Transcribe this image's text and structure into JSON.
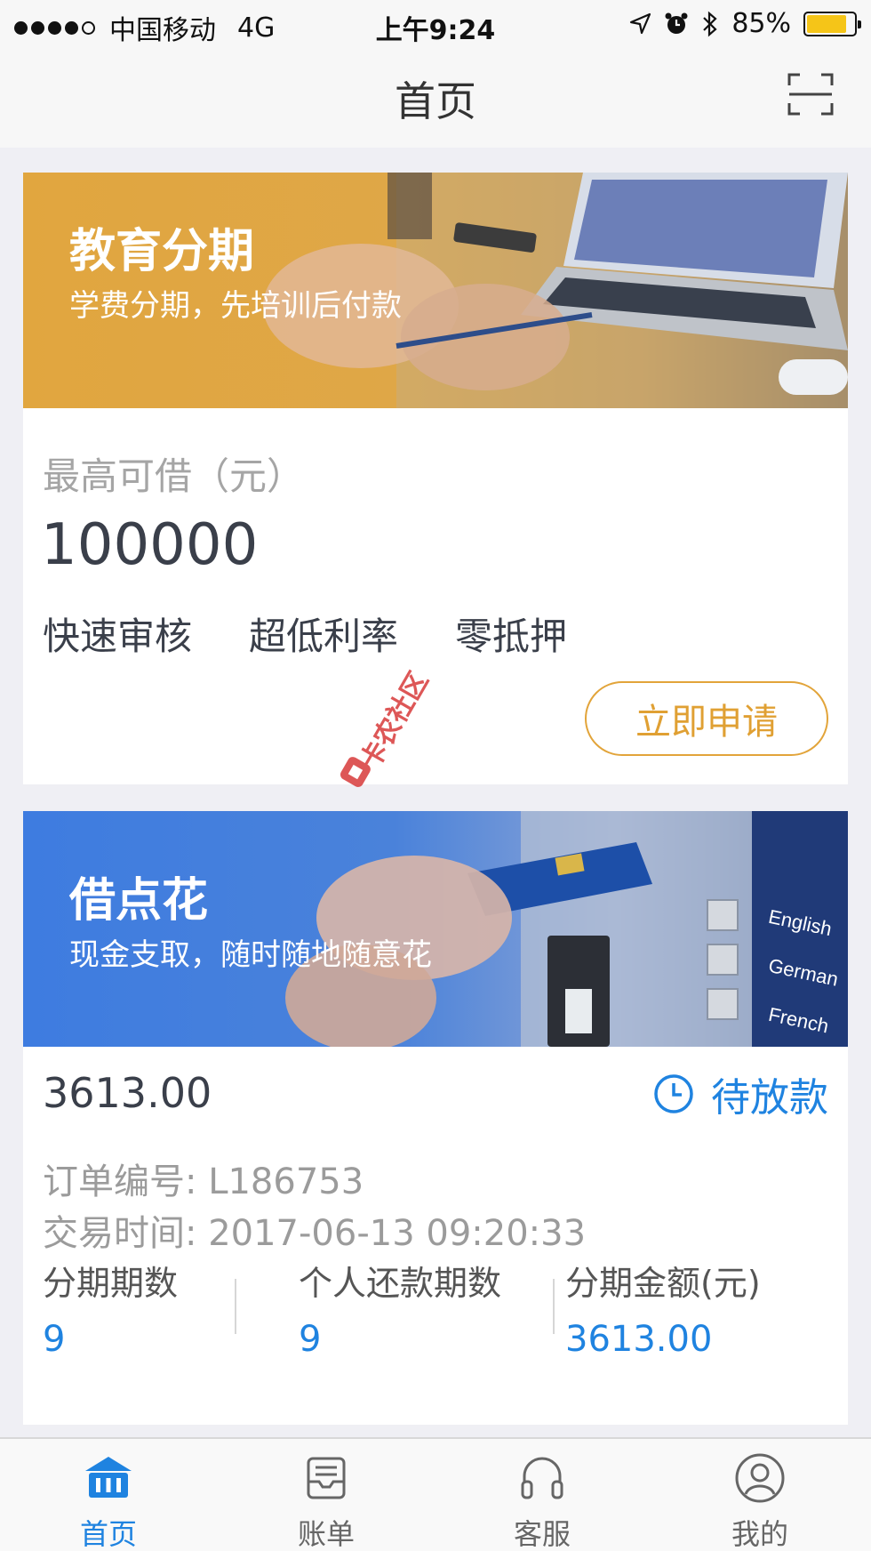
{
  "status_bar": {
    "carrier": "中国移动",
    "network": "4G",
    "time": "上午9:24",
    "battery": "85%",
    "battery_level": 0.85
  },
  "nav": {
    "title": "首页"
  },
  "edu_card": {
    "banner_title": "教育分期",
    "banner_subtitle": "学费分期，先培训后付款",
    "max_label": "最高可借（元）",
    "max_amount": "100000",
    "features": [
      "快速审核",
      "超低利率",
      "零抵押"
    ],
    "apply_button": "立即申请"
  },
  "cash_card": {
    "banner_title": "借点花",
    "banner_subtitle": "现金支取，随时随地随意花",
    "amount": "3613.00",
    "status": "待放款",
    "order_no": "订单编号: L186753",
    "trade_time": "交易时间: 2017-06-13 09:20:33",
    "stats": [
      {
        "label": "分期期数",
        "value": "9"
      },
      {
        "label": "个人还款期数",
        "value": "9"
      },
      {
        "label": "分期金额(元)",
        "value": "3613.00"
      }
    ]
  },
  "watermark": "卡农社区",
  "tabbar": {
    "items": [
      {
        "label": "首页",
        "icon": "home-icon",
        "active": true
      },
      {
        "label": "账单",
        "icon": "bill-icon",
        "active": false
      },
      {
        "label": "客服",
        "icon": "headset-icon",
        "active": false
      },
      {
        "label": "我的",
        "icon": "user-icon",
        "active": false
      }
    ]
  },
  "colors": {
    "accent_blue": "#1f83e0",
    "accent_orange": "#e2a43a",
    "banner_edu": "#e1a63f",
    "banner_cash": "#3e7ce0"
  }
}
